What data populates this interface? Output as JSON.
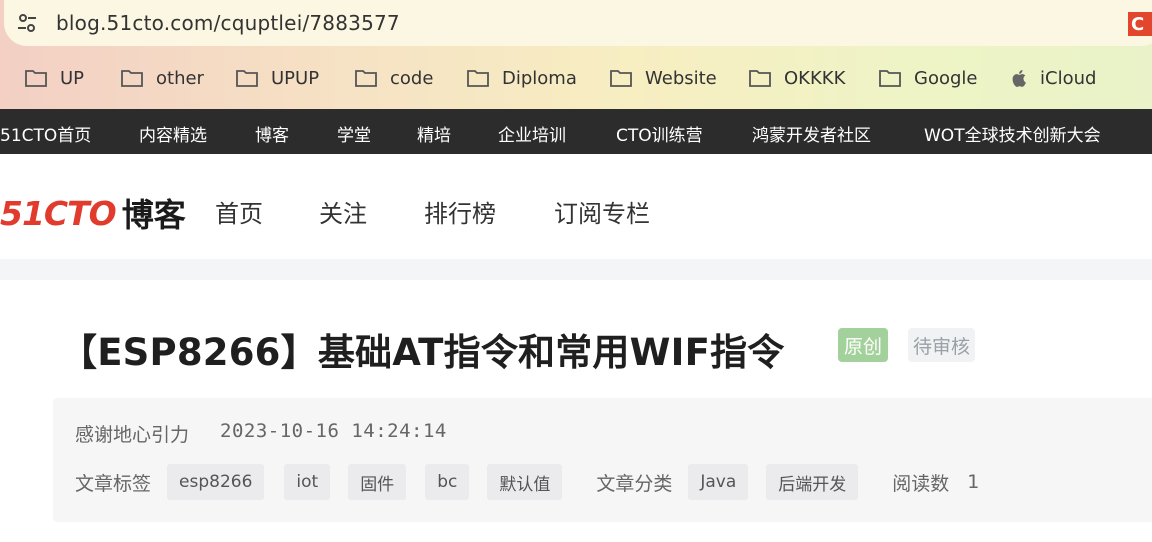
{
  "browser": {
    "url": "blog.51cto.com/cquptlei/7883577",
    "bookmarks": [
      "UP",
      "other",
      "UPUP",
      "code",
      "Diploma",
      "Website",
      "OKKKK",
      "Google",
      "iCloud"
    ],
    "partial_bookmark": "C"
  },
  "topnav": [
    "51CTO首页",
    "内容精选",
    "博客",
    "学堂",
    "精培",
    "企业培训",
    "CTO训练营",
    "鸿蒙开发者社区",
    "WOT全球技术创新大会"
  ],
  "header": {
    "logo_red": "51CTO",
    "logo_black": "博客",
    "nav": [
      "首页",
      "关注",
      "排行榜",
      "订阅专栏"
    ]
  },
  "article": {
    "title": "【ESP8266】基础AT指令和常用WIF指令",
    "badge_original": "原创",
    "badge_review": "待审核",
    "author": "感谢地心引力",
    "date": "2023-10-16 14:24:14",
    "tags_label": "文章标签",
    "tags": [
      "esp8266",
      "iot",
      "固件",
      "bc",
      "默认值"
    ],
    "category_label": "文章分类",
    "categories": [
      "Java",
      "后端开发"
    ],
    "reads_label": "阅读数",
    "reads_value": "1"
  },
  "colors": {
    "brand_red": "#e03b2c",
    "nav_dark": "#2c2c2c",
    "badge_green": "#a3d19b"
  }
}
